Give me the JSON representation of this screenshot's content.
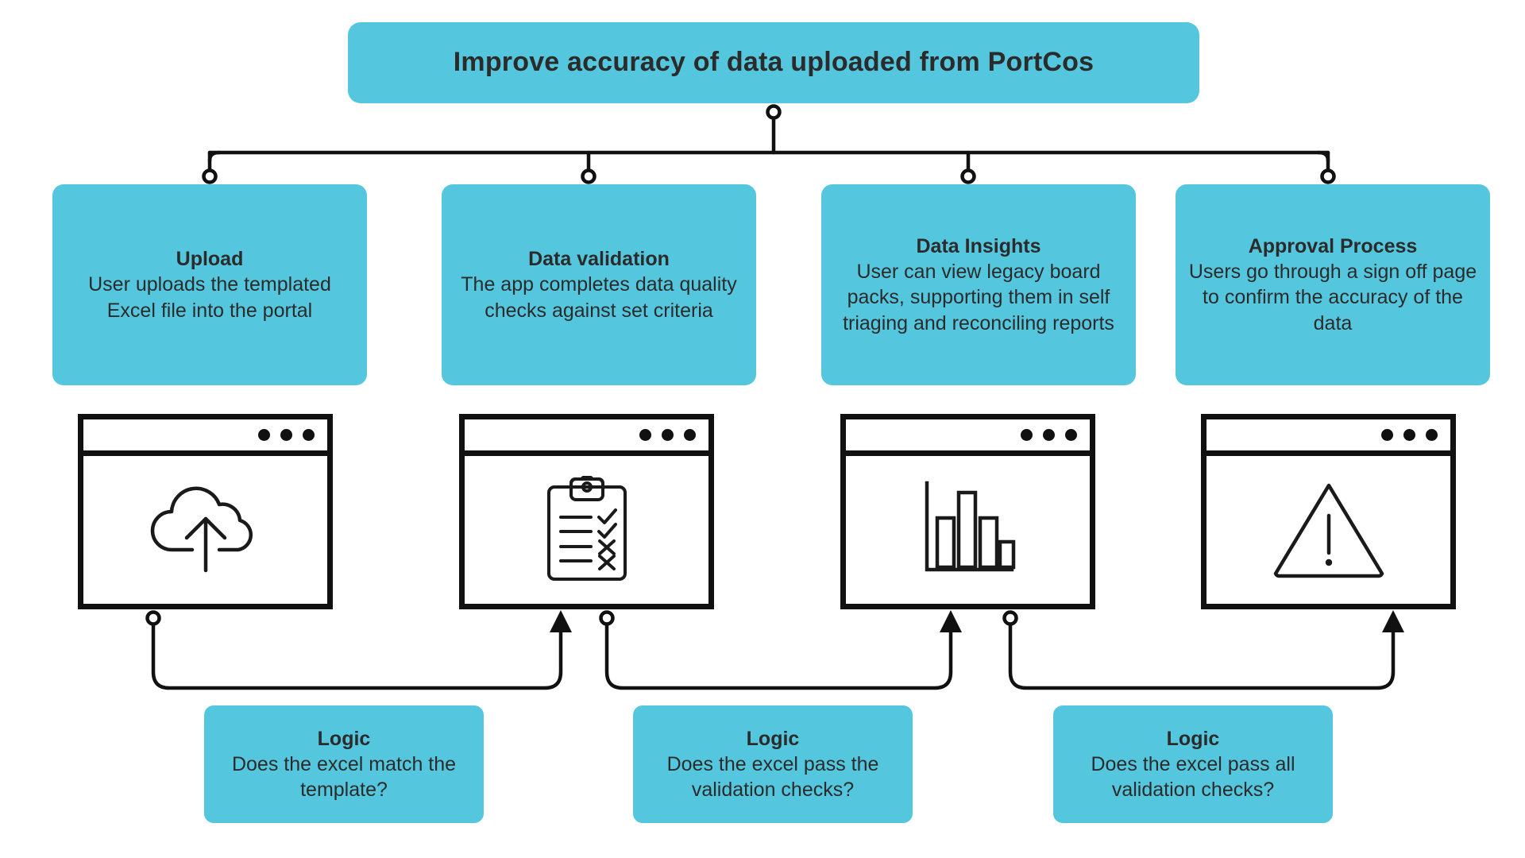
{
  "diagram": {
    "type": "flowchart",
    "accent_color": "#54c7de",
    "line_color": "#111111",
    "text_color": "#2b2b2b",
    "background_color": "#ffffff",
    "root": {
      "title": "Improve accuracy of data uploaded from PortCos"
    },
    "stages": [
      {
        "title": "Upload",
        "body": "User uploads the templated Excel file into the portal",
        "icon": "cloud-upload-icon",
        "window_dots": 3
      },
      {
        "title": "Data validation",
        "body": "The app completes data quality checks against set criteria",
        "icon": "clipboard-checklist-icon",
        "window_dots": 3
      },
      {
        "title": "Data Insights",
        "body": "User can view legacy board packs, supporting them in self triaging and reconciling reports",
        "icon": "bar-chart-icon",
        "window_dots": 3
      },
      {
        "title": "Approval Process",
        "body": "Users go through a sign off page to confirm the accuracy of the data",
        "icon": "warning-triangle-icon",
        "window_dots": 3
      }
    ],
    "logic_gates": [
      {
        "title": "Logic",
        "body": "Does the excel match the template?"
      },
      {
        "title": "Logic",
        "body": "Does the excel pass the validation checks?"
      },
      {
        "title": "Logic",
        "body": "Does the excel pass all validation checks?"
      }
    ]
  }
}
